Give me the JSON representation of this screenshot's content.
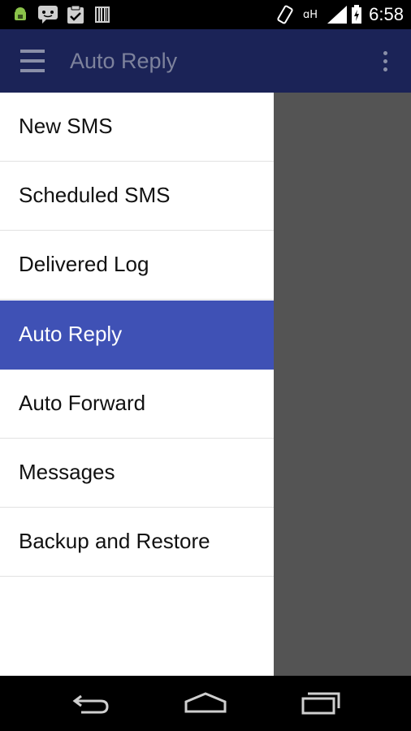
{
  "status_bar": {
    "time": "6:58",
    "left_icons": [
      "android-debug-icon",
      "chat-icon",
      "clipboard-check-icon",
      "barcode-icon"
    ],
    "right_icons": [
      "rotate-icon",
      "hplus-network-icon",
      "signal-icon",
      "battery-icon"
    ]
  },
  "app_bar": {
    "title": "Auto Reply",
    "menu_icon": "hamburger-icon",
    "overflow_icon": "overflow-menu-icon",
    "color": "#1b2357"
  },
  "drawer": {
    "items": [
      {
        "label": "New SMS",
        "active": false
      },
      {
        "label": "Scheduled SMS",
        "active": false
      },
      {
        "label": "Delivered Log",
        "active": false
      },
      {
        "label": "Auto Reply",
        "active": true
      },
      {
        "label": "Auto Forward",
        "active": false
      },
      {
        "label": "Messages",
        "active": false
      },
      {
        "label": "Backup and Restore",
        "active": false
      }
    ],
    "active_color": "#3f51b5",
    "scrim_color": "#545454"
  },
  "nav_bar": {
    "buttons": [
      "back-icon",
      "home-icon",
      "recents-icon"
    ]
  }
}
